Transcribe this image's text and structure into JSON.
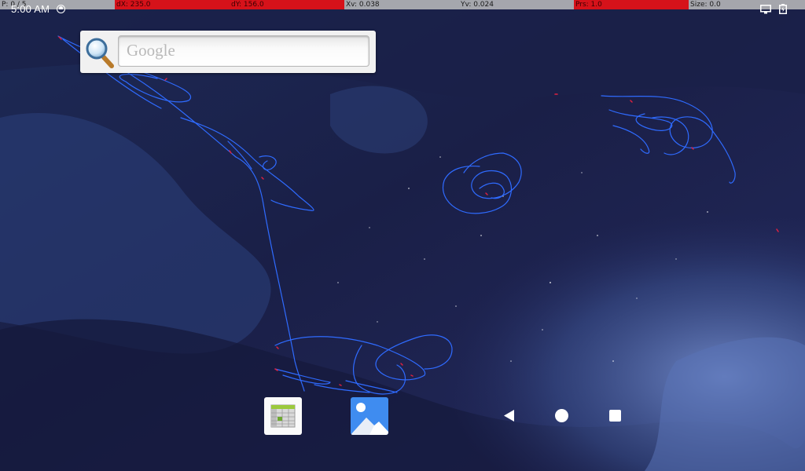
{
  "debug_bar": {
    "cells": [
      {
        "text": "P: 0 / 5",
        "state": "normal"
      },
      {
        "text": "dX: 235.0",
        "state": "highlight"
      },
      {
        "text": "dY: 156.0",
        "state": "highlight"
      },
      {
        "text": "Xv: 0.038",
        "state": "normal"
      },
      {
        "text": "Yv: 0.024",
        "state": "normal"
      },
      {
        "text": "Prs: 1.0",
        "state": "highlight"
      },
      {
        "text": "Size: 0.0",
        "state": "normal"
      }
    ]
  },
  "status_bar": {
    "time": "5:00 AM",
    "icons": [
      "sync-icon",
      "cast-icon",
      "battery-icon"
    ]
  },
  "search_widget": {
    "placeholder": "Google",
    "icon": "magnifier-icon"
  },
  "dock": {
    "apps": [
      {
        "name": "spreadsheet-app-icon"
      },
      {
        "name": "gallery-app-icon"
      }
    ]
  },
  "nav_bar": {
    "buttons": [
      "back",
      "home",
      "recents"
    ]
  },
  "colors": {
    "trace_blue": "#2f6bff",
    "trace_red": "#e02040",
    "highlight_red": "#d6121a",
    "status_gray": "#bebebe",
    "gallery_blue": "#3f8cf0"
  }
}
